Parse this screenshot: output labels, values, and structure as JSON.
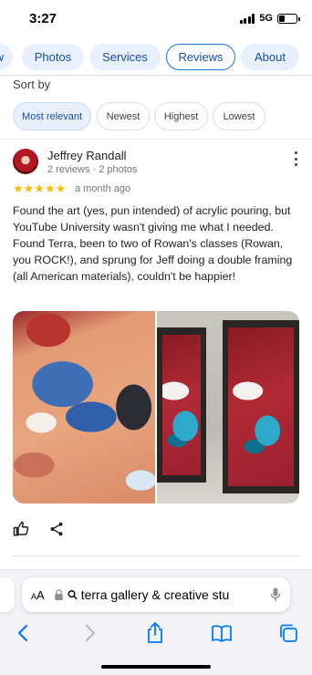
{
  "status_bar": {
    "time": "3:27",
    "network": "5G",
    "battery_level": 0.35
  },
  "tabs": [
    {
      "label": "w",
      "active": false
    },
    {
      "label": "Photos",
      "active": false
    },
    {
      "label": "Services",
      "active": false
    },
    {
      "label": "Reviews",
      "active": true
    },
    {
      "label": "About",
      "active": false
    }
  ],
  "sort": {
    "label": "Sort by",
    "options": [
      "Most relevant",
      "Newest",
      "Highest",
      "Lowest"
    ],
    "selected": "Most relevant"
  },
  "review": {
    "author": "Jeffrey Randall",
    "meta": "2 reviews · 2 photos",
    "rating": 5,
    "stars": "★★★★★",
    "date": "a month ago",
    "text": "Found the art (yes, pun intended) of acrylic pouring, but YouTube University wasn't giving me what I needed. Found Terra, been to two of Rowan's classes (Rowan, you ROCK!), and sprung for Jeff doing a double framing (all American materials), couldn't be happier!",
    "photos": [
      "acrylic-pour-closeup-photo",
      "framed-paintings-photo"
    ],
    "actions": {
      "like_icon": "thumb-up-icon",
      "share_icon": "share-icon"
    }
  },
  "browser": {
    "text_size_label": "AA",
    "url": "terra gallery & creative stu",
    "toolbar_icons": [
      "back-icon",
      "forward-icon",
      "share-icon",
      "bookmarks-icon",
      "tabs-icon"
    ]
  },
  "colors": {
    "accent": "#1a73e8",
    "chip_selected_bg": "#e8f0fe",
    "star": "#fbbc04",
    "ios_blue": "#007aff"
  }
}
